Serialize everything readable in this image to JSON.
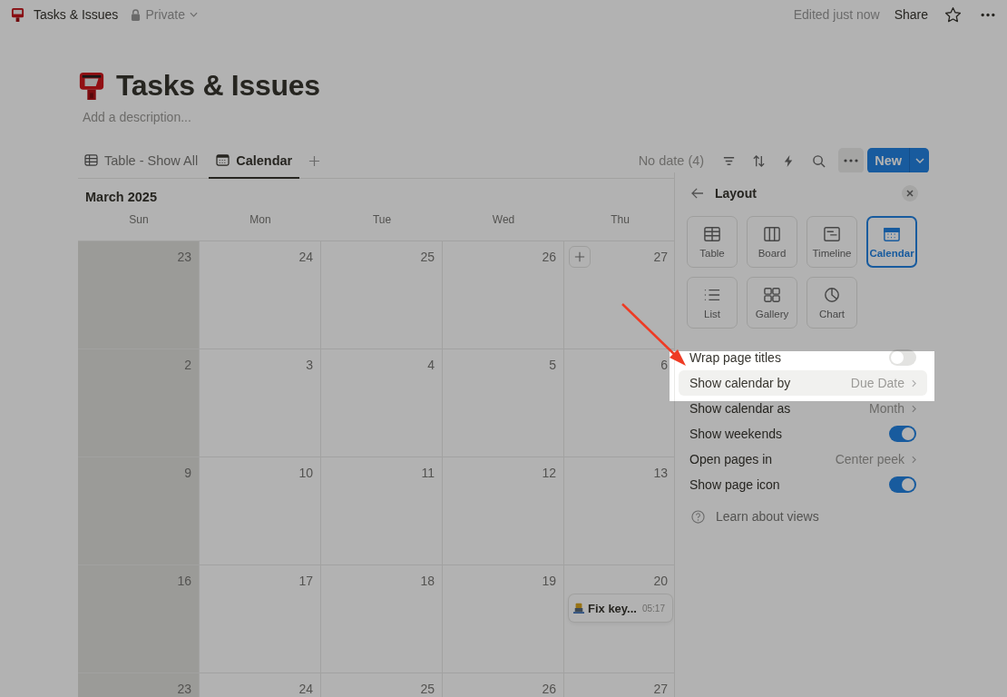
{
  "topbar": {
    "page_title": "Tasks & Issues",
    "privacy": "Private",
    "edited": "Edited just now",
    "share": "Share"
  },
  "page": {
    "title": "Tasks & Issues",
    "description_placeholder": "Add a description..."
  },
  "view_tabs": [
    {
      "label": "Table - Show All",
      "kind": "table",
      "selected": false
    },
    {
      "label": "Calendar",
      "kind": "calendar",
      "selected": true
    }
  ],
  "toolbar": {
    "no_date": "No date (4)",
    "new_button": "New"
  },
  "calendar": {
    "month": "March 2025",
    "weekdays": [
      "Sun",
      "Mon",
      "Tue",
      "Wed",
      "Thu"
    ],
    "weeks": [
      [
        {
          "day": "23",
          "weekend": true,
          "hovered": false
        },
        {
          "day": "24",
          "weekend": false,
          "hovered": false
        },
        {
          "day": "25",
          "weekend": false,
          "hovered": false
        },
        {
          "day": "26",
          "weekend": false,
          "hovered": false
        },
        {
          "day": "27",
          "weekend": false,
          "hovered": true
        }
      ],
      [
        {
          "day": "2",
          "weekend": true,
          "hovered": false
        },
        {
          "day": "3",
          "weekend": false,
          "hovered": false
        },
        {
          "day": "4",
          "weekend": false,
          "hovered": false
        },
        {
          "day": "5",
          "weekend": false,
          "hovered": false
        },
        {
          "day": "6",
          "weekend": false,
          "hovered": false
        }
      ],
      [
        {
          "day": "9",
          "weekend": true,
          "hovered": false
        },
        {
          "day": "10",
          "weekend": false,
          "hovered": false
        },
        {
          "day": "11",
          "weekend": false,
          "hovered": false
        },
        {
          "day": "12",
          "weekend": false,
          "hovered": false
        },
        {
          "day": "13",
          "weekend": false,
          "hovered": false
        }
      ],
      [
        {
          "day": "16",
          "weekend": true,
          "hovered": false
        },
        {
          "day": "17",
          "weekend": false,
          "hovered": false
        },
        {
          "day": "18",
          "weekend": false,
          "hovered": false
        },
        {
          "day": "19",
          "weekend": false,
          "hovered": false
        },
        {
          "day": "20",
          "weekend": false,
          "hovered": false,
          "events": [
            {
              "title": "Fix key...",
              "time": "05:17"
            }
          ]
        }
      ],
      [
        {
          "day": "23",
          "weekend": true,
          "hovered": false
        },
        {
          "day": "24",
          "weekend": false,
          "hovered": false
        },
        {
          "day": "25",
          "weekend": false,
          "hovered": false
        },
        {
          "day": "26",
          "weekend": false,
          "hovered": false
        },
        {
          "day": "27",
          "weekend": false,
          "hovered": false
        }
      ]
    ]
  },
  "layout_panel": {
    "title": "Layout",
    "layouts": [
      {
        "label": "Table",
        "kind": "table",
        "selected": false
      },
      {
        "label": "Board",
        "kind": "board",
        "selected": false
      },
      {
        "label": "Timeline",
        "kind": "timeline",
        "selected": false
      },
      {
        "label": "Calendar",
        "kind": "calendar",
        "selected": true
      },
      {
        "label": "List",
        "kind": "list",
        "selected": false
      },
      {
        "label": "Gallery",
        "kind": "gallery",
        "selected": false
      },
      {
        "label": "Chart",
        "kind": "chart",
        "selected": false
      }
    ],
    "settings": [
      {
        "kind": "toggle",
        "label": "Wrap page titles",
        "on": false,
        "highlighted": false
      },
      {
        "kind": "select",
        "label": "Show calendar by",
        "value": "Due Date",
        "highlighted": true
      },
      {
        "kind": "select",
        "label": "Show calendar as",
        "value": "Month",
        "highlighted": false
      },
      {
        "kind": "toggle",
        "label": "Show weekends",
        "on": true,
        "highlighted": false
      },
      {
        "kind": "select",
        "label": "Open pages in",
        "value": "Center peek",
        "highlighted": false
      },
      {
        "kind": "toggle",
        "label": "Show page icon",
        "on": true,
        "highlighted": false
      }
    ],
    "help_link": "Learn about views"
  }
}
